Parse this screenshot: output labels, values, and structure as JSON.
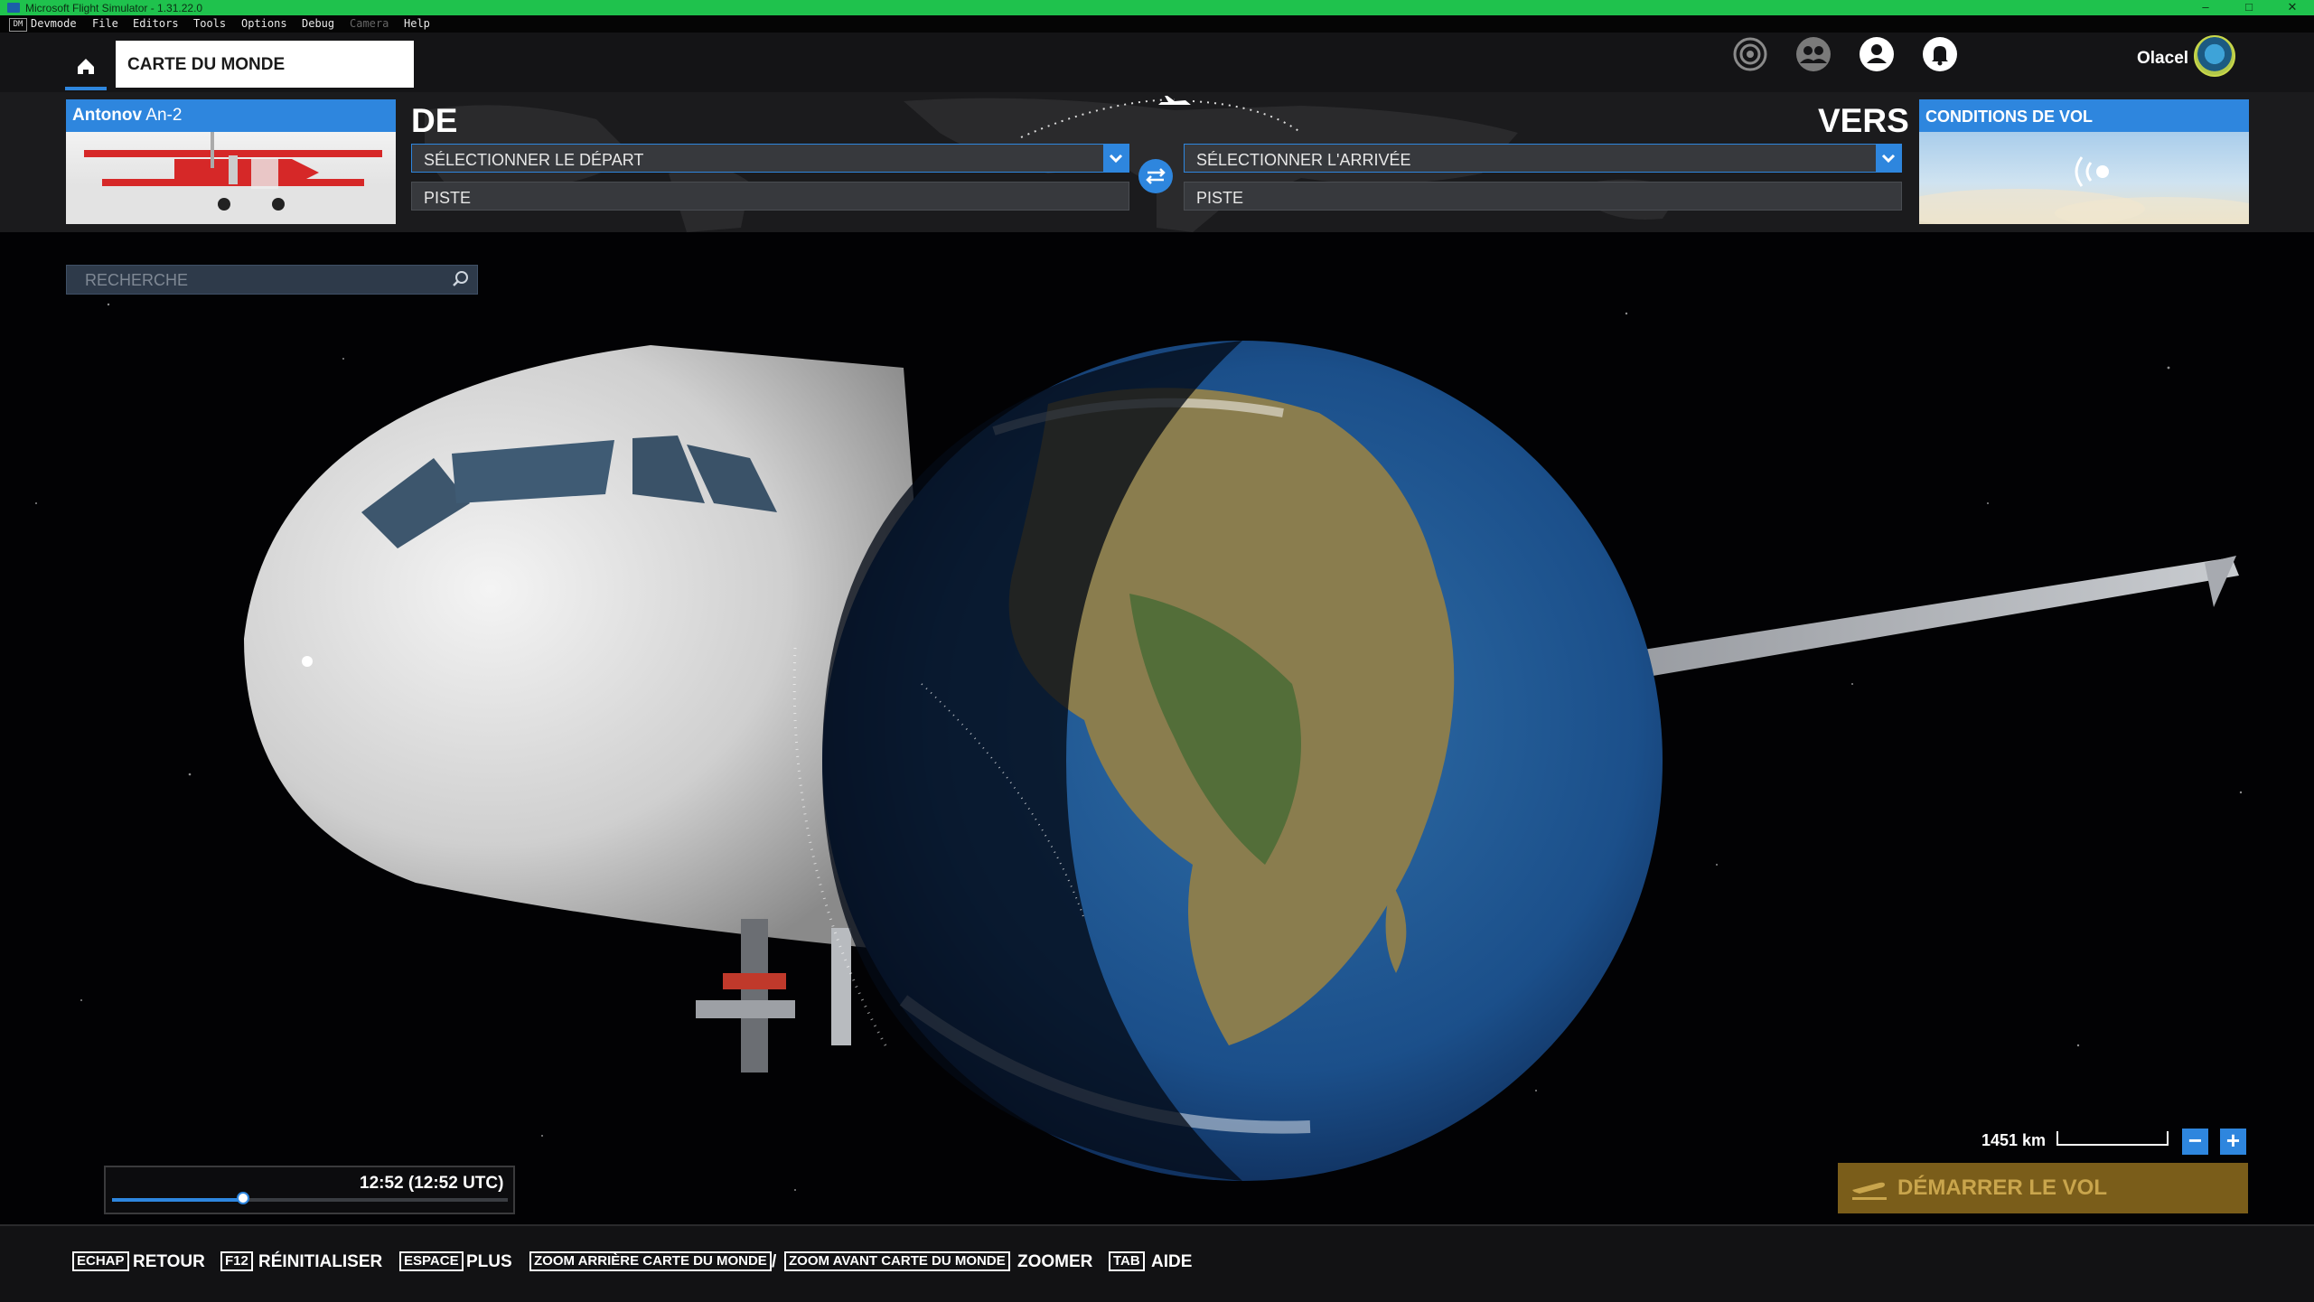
{
  "window": {
    "title": "Microsoft Flight Simulator - 1.31.22.0",
    "controls": [
      "minimize-icon",
      "maximize-icon",
      "close-icon"
    ]
  },
  "devmenu": {
    "items": [
      "Devmode",
      "File",
      "Editors",
      "Tools",
      "Options",
      "Debug",
      "Camera",
      "Help"
    ]
  },
  "nav": {
    "tab": "CARTE DU MONDE",
    "user": "Olacel",
    "icons": [
      "home-icon",
      "target-icon",
      "multiplayer-icon",
      "profile-icon",
      "notification-icon"
    ]
  },
  "flight": {
    "aircraft_brand": "Antonov",
    "aircraft_model": "An-2",
    "from_label": "DE",
    "to_label": "VERS",
    "departure": "SÉLECTIONNER LE DÉPART",
    "arrival": "SÉLECTIONNER L'ARRIVÉE",
    "runway_from": "PISTE",
    "runway_to": "PISTE",
    "conditions": "CONDITIONS DE VOL"
  },
  "map": {
    "search_placeholder": "RECHERCHE",
    "scale_label": "1451 km",
    "zoom_out": "−",
    "zoom_in": "+",
    "time": "12:52 (12:52 UTC)",
    "time_progress": 0.33,
    "start_button": "DÉMARRER LE VOL"
  },
  "footer": {
    "k1": "ECHAP",
    "l1": "RETOUR",
    "k2": "F12",
    "l2": "RÉINITIALISER",
    "k3": "ESPACE",
    "l3": "PLUS",
    "k4": "ZOOM ARRIÈRE CARTE DU MONDE",
    "sep": "/",
    "k5": "ZOOM AVANT CARTE DU MONDE",
    "l5": "ZOOMER",
    "k6": "TAB",
    "l6": "AIDE"
  },
  "colors": {
    "accent": "#2e86de",
    "titlebar": "#1fc24d",
    "start_button": "#7a5d1a"
  }
}
